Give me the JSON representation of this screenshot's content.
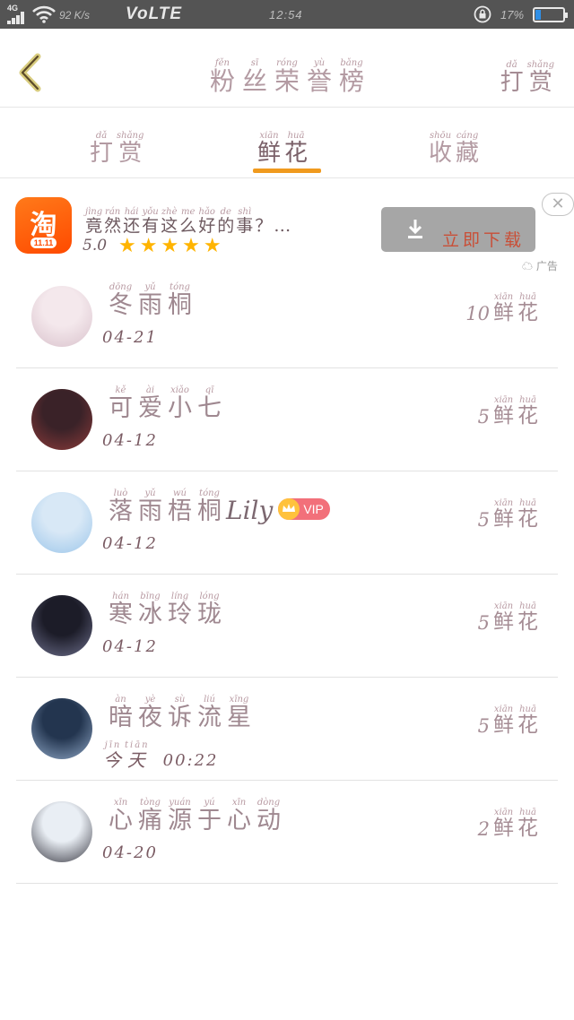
{
  "status_bar": {
    "network": "4G",
    "speed": "92 K/s",
    "volte": "VoLTE",
    "time": "12:54",
    "battery": "17%"
  },
  "header": {
    "title": [
      {
        "h": "粉",
        "p": "fěn"
      },
      {
        "h": "丝",
        "p": "sī"
      },
      {
        "h": "荣",
        "p": "róng"
      },
      {
        "h": "誉",
        "p": "yù"
      },
      {
        "h": "榜",
        "p": "bǎng"
      }
    ],
    "reward_button": [
      {
        "h": "打",
        "p": "dǎ"
      },
      {
        "h": "赏",
        "p": "shǎng"
      }
    ]
  },
  "tabs": [
    {
      "name": "tab-reward",
      "active": false,
      "chars": [
        {
          "h": "打",
          "p": "dǎ"
        },
        {
          "h": "赏",
          "p": "shǎng"
        }
      ]
    },
    {
      "name": "tab-flowers",
      "active": true,
      "chars": [
        {
          "h": "鲜",
          "p": "xiān"
        },
        {
          "h": "花",
          "p": "huā"
        }
      ]
    },
    {
      "name": "tab-favorites",
      "active": false,
      "chars": [
        {
          "h": "收",
          "p": "shōu"
        },
        {
          "h": "藏",
          "p": "cáng"
        }
      ]
    }
  ],
  "ad": {
    "app_icon_glyph": "淘",
    "app_icon_badge": "11.11",
    "text": [
      {
        "h": "竟",
        "p": "jìng"
      },
      {
        "h": "然",
        "p": "rán"
      },
      {
        "h": "还",
        "p": "hái"
      },
      {
        "h": "有",
        "p": "yǒu"
      },
      {
        "h": "这",
        "p": "zhè"
      },
      {
        "h": "么",
        "p": "me"
      },
      {
        "h": "好",
        "p": "hǎo"
      },
      {
        "h": "的",
        "p": "de"
      },
      {
        "h": "事",
        "p": "shì"
      },
      {
        "h": "？",
        "p": ""
      },
      {
        "h": "…",
        "p": ""
      }
    ],
    "rating": "5.0",
    "stars": 5,
    "download_label": [
      {
        "h": "立",
        "p": ""
      },
      {
        "h": "即",
        "p": ""
      },
      {
        "h": "下",
        "p": ""
      },
      {
        "h": "载",
        "p": ""
      }
    ],
    "close_label": "✕",
    "source": "☁ 广告"
  },
  "fans": [
    {
      "name": [
        {
          "h": "冬",
          "p": "dōng"
        },
        {
          "h": "雨",
          "p": "yǔ"
        },
        {
          "h": "桐",
          "p": "tóng"
        }
      ],
      "name_latin": "",
      "vip": false,
      "date": "04-21",
      "date_prefix": [],
      "count": "10",
      "unit": [
        {
          "h": "鲜",
          "p": "xiān"
        },
        {
          "h": "花",
          "p": "huā"
        }
      ],
      "avatar_colors": [
        "#f4e8ec",
        "#d9c2cc"
      ]
    },
    {
      "name": [
        {
          "h": "可",
          "p": "kě"
        },
        {
          "h": "爱",
          "p": "ài"
        },
        {
          "h": "小",
          "p": "xiǎo"
        },
        {
          "h": "七",
          "p": "qī"
        }
      ],
      "name_latin": "",
      "vip": false,
      "date": "04-12",
      "date_prefix": [],
      "count": "5",
      "unit": [
        {
          "h": "鲜",
          "p": "xiān"
        },
        {
          "h": "花",
          "p": "huā"
        }
      ],
      "avatar_colors": [
        "#3a2228",
        "#8c3a3a"
      ]
    },
    {
      "name": [
        {
          "h": "落",
          "p": "luò"
        },
        {
          "h": "雨",
          "p": "yǔ"
        },
        {
          "h": "梧",
          "p": "wú"
        },
        {
          "h": "桐",
          "p": "tóng"
        }
      ],
      "name_latin": "Lily",
      "vip": true,
      "vip_label": "VIP",
      "date": "04-12",
      "date_prefix": [],
      "count": "5",
      "unit": [
        {
          "h": "鲜",
          "p": "xiān"
        },
        {
          "h": "花",
          "p": "huā"
        }
      ],
      "avatar_colors": [
        "#d8e8f6",
        "#9cc6ea"
      ]
    },
    {
      "name": [
        {
          "h": "寒",
          "p": "hán"
        },
        {
          "h": "冰",
          "p": "bīng"
        },
        {
          "h": "玲",
          "p": "líng"
        },
        {
          "h": "珑",
          "p": "lóng"
        }
      ],
      "name_latin": "",
      "vip": false,
      "date": "04-12",
      "date_prefix": [],
      "count": "5",
      "unit": [
        {
          "h": "鲜",
          "p": "xiān"
        },
        {
          "h": "花",
          "p": "huā"
        }
      ],
      "avatar_colors": [
        "#1c1c28",
        "#6d6f8c"
      ]
    },
    {
      "name": [
        {
          "h": "暗",
          "p": "àn"
        },
        {
          "h": "夜",
          "p": "yè"
        },
        {
          "h": "诉",
          "p": "sù"
        },
        {
          "h": "流",
          "p": "liú"
        },
        {
          "h": "星",
          "p": "xīng"
        }
      ],
      "name_latin": "",
      "vip": false,
      "date": "00:22",
      "date_prefix": [
        {
          "h": "今",
          "p": "jīn"
        },
        {
          "h": "天",
          "p": "tiān"
        }
      ],
      "count": "5",
      "unit": [
        {
          "h": "鲜",
          "p": "xiān"
        },
        {
          "h": "花",
          "p": "huā"
        }
      ],
      "avatar_colors": [
        "#23354f",
        "#8fa7c6"
      ]
    },
    {
      "name": [
        {
          "h": "心",
          "p": "xīn"
        },
        {
          "h": "痛",
          "p": "tòng"
        },
        {
          "h": "源",
          "p": "yuán"
        },
        {
          "h": "于",
          "p": "yú"
        },
        {
          "h": "心",
          "p": "xīn"
        },
        {
          "h": "动",
          "p": "dòng"
        }
      ],
      "name_latin": "",
      "vip": false,
      "date": "04-20",
      "date_prefix": [],
      "count": "2",
      "unit": [
        {
          "h": "鲜",
          "p": "xiān"
        },
        {
          "h": "花",
          "p": "huā"
        }
      ],
      "avatar_colors": [
        "#e9eef4",
        "#3a3a44"
      ]
    }
  ],
  "colors": {
    "tab_underline": "#f09a1e",
    "star": "#ffb400",
    "vip_badge": "#f2707a"
  }
}
